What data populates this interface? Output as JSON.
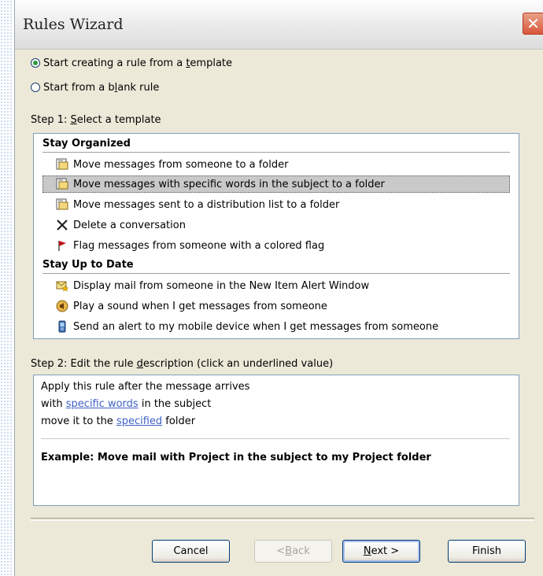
{
  "window": {
    "title": "Rules Wizard",
    "close_glyph": "✕"
  },
  "options": {
    "template_prefix": "Start creating a rule from a ",
    "template_u": "t",
    "template_suffix": "emplate",
    "blank_prefix": "Start from a b",
    "blank_u": "l",
    "blank_suffix": "ank rule",
    "selected": "template"
  },
  "step1": {
    "prefix": "Step 1: ",
    "u": "S",
    "suffix": "elect a template"
  },
  "groups": [
    {
      "name": "Stay Organized",
      "items": [
        {
          "label": "Move messages from someone to a folder",
          "icon": "move-to-folder-icon"
        },
        {
          "label": "Move messages with specific words in the subject to a folder",
          "icon": "move-to-folder-icon",
          "selected": true
        },
        {
          "label": "Move messages sent to a distribution list to a folder",
          "icon": "move-to-folder-icon"
        },
        {
          "label": "Delete a conversation",
          "icon": "delete-x-icon"
        },
        {
          "label": "Flag messages from someone with a colored flag",
          "icon": "red-flag-icon"
        }
      ]
    },
    {
      "name": "Stay Up to Date",
      "items": [
        {
          "label": "Display mail from someone in the New Item Alert Window",
          "icon": "new-item-alert-icon"
        },
        {
          "label": "Play a sound when I get messages from someone",
          "icon": "speaker-icon"
        },
        {
          "label": "Send an alert to my mobile device when I get messages from someone",
          "icon": "mobile-device-icon"
        }
      ]
    }
  ],
  "step2": {
    "prefix": "Step 2: Edit the rule ",
    "u": "d",
    "suffix": "escription (click an underlined value)"
  },
  "description": {
    "line1": "Apply this rule after the message arrives",
    "line2_prefix": "with ",
    "line2_link": "specific words",
    "line2_suffix": " in the subject",
    "line3_prefix": "move it to the ",
    "line3_link": "specified",
    "line3_suffix": " folder",
    "example": "Example: Move mail with Project in the subject to my Project folder"
  },
  "buttons": {
    "cancel": "Cancel",
    "back_prefix": "< ",
    "back_u": "B",
    "back_suffix": "ack",
    "next_u": "N",
    "next_suffix": "ext >",
    "finish": "Finish"
  },
  "colors": {
    "link": "#3f62c6",
    "dialog_bg": "#ece9d8",
    "close": "#d9573b"
  }
}
